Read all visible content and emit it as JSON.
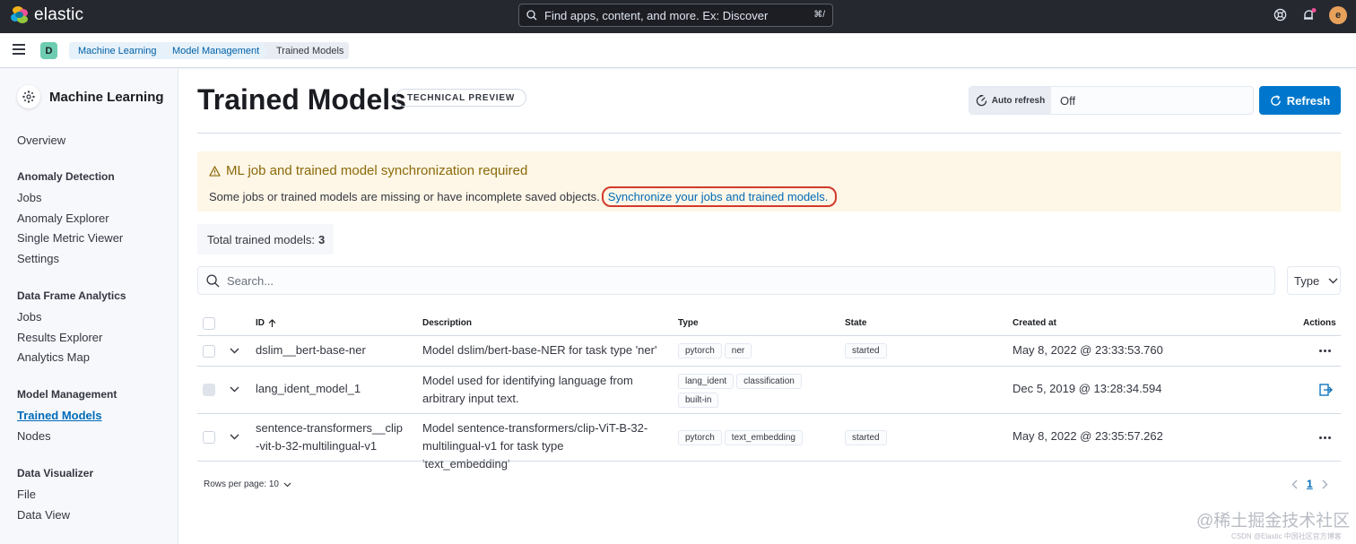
{
  "header": {
    "logo_text": "elastic",
    "search_placeholder": "Find apps, content, and more. Ex: Discover",
    "search_shortcut": "⌘/",
    "avatar_letter": "e"
  },
  "breadcrumbs": {
    "space_letter": "D",
    "items": [
      "Machine Learning",
      "Model Management",
      "Trained Models"
    ]
  },
  "sidebar": {
    "title": "Machine Learning",
    "overview": "Overview",
    "sections": [
      {
        "heading": "Anomaly Detection",
        "items": [
          "Jobs",
          "Anomaly Explorer",
          "Single Metric Viewer",
          "Settings"
        ]
      },
      {
        "heading": "Data Frame Analytics",
        "items": [
          "Jobs",
          "Results Explorer",
          "Analytics Map"
        ]
      },
      {
        "heading": "Model Management",
        "items": [
          "Trained Models",
          "Nodes"
        ]
      },
      {
        "heading": "Data Visualizer",
        "items": [
          "File",
          "Data View"
        ]
      }
    ]
  },
  "page": {
    "title": "Trained Models",
    "badge": "TECHNICAL PREVIEW",
    "auto_refresh_label": "Auto refresh",
    "auto_refresh_value": "Off",
    "refresh_label": "Refresh"
  },
  "callout": {
    "title": "ML job and trained model synchronization required",
    "body": "Some jobs or trained models are missing or have incomplete saved objects.",
    "link": "Synchronize your jobs and trained models."
  },
  "total": {
    "label": "Total trained models:",
    "count": "3"
  },
  "table": {
    "search_placeholder": "Search...",
    "type_filter": "Type",
    "columns": [
      "ID",
      "Description",
      "Type",
      "State",
      "Created at",
      "Actions"
    ],
    "rows": [
      {
        "id": "dslim__bert-base-ner",
        "description": "Model dslim/bert-base-NER for task type 'ner'",
        "types": [
          "pytorch",
          "ner"
        ],
        "state": "started",
        "created": "May 8, 2022 @ 23:33:53.760"
      },
      {
        "id": "lang_ident_model_1",
        "description": "Model used for identifying language from arbitrary input text.",
        "types": [
          "lang_ident",
          "classification",
          "built-in"
        ],
        "state": "",
        "created": "Dec 5, 2019 @ 13:28:34.594"
      },
      {
        "id": "sentence-transformers__clip-vit-b-32-multilingual-v1",
        "description": "Model sentence-transformers/clip-ViT-B-32-multilingual-v1 for task type 'text_embedding'",
        "types": [
          "pytorch",
          "text_embedding"
        ],
        "state": "started",
        "created": "May 8, 2022 @ 23:35:57.262"
      }
    ],
    "rows_per_page": "Rows per page: 10",
    "current_page": "1"
  },
  "watermark": {
    "main": "@稀土掘金技术社区",
    "sub": "CSDN @Elastic 中国社区官方博客"
  },
  "colors": {
    "header_bg": "#25282f",
    "accent": "#0077cc",
    "link": "#006bb8",
    "warning_bg": "#fef6e6",
    "highlight_ring": "#d33a2c"
  }
}
